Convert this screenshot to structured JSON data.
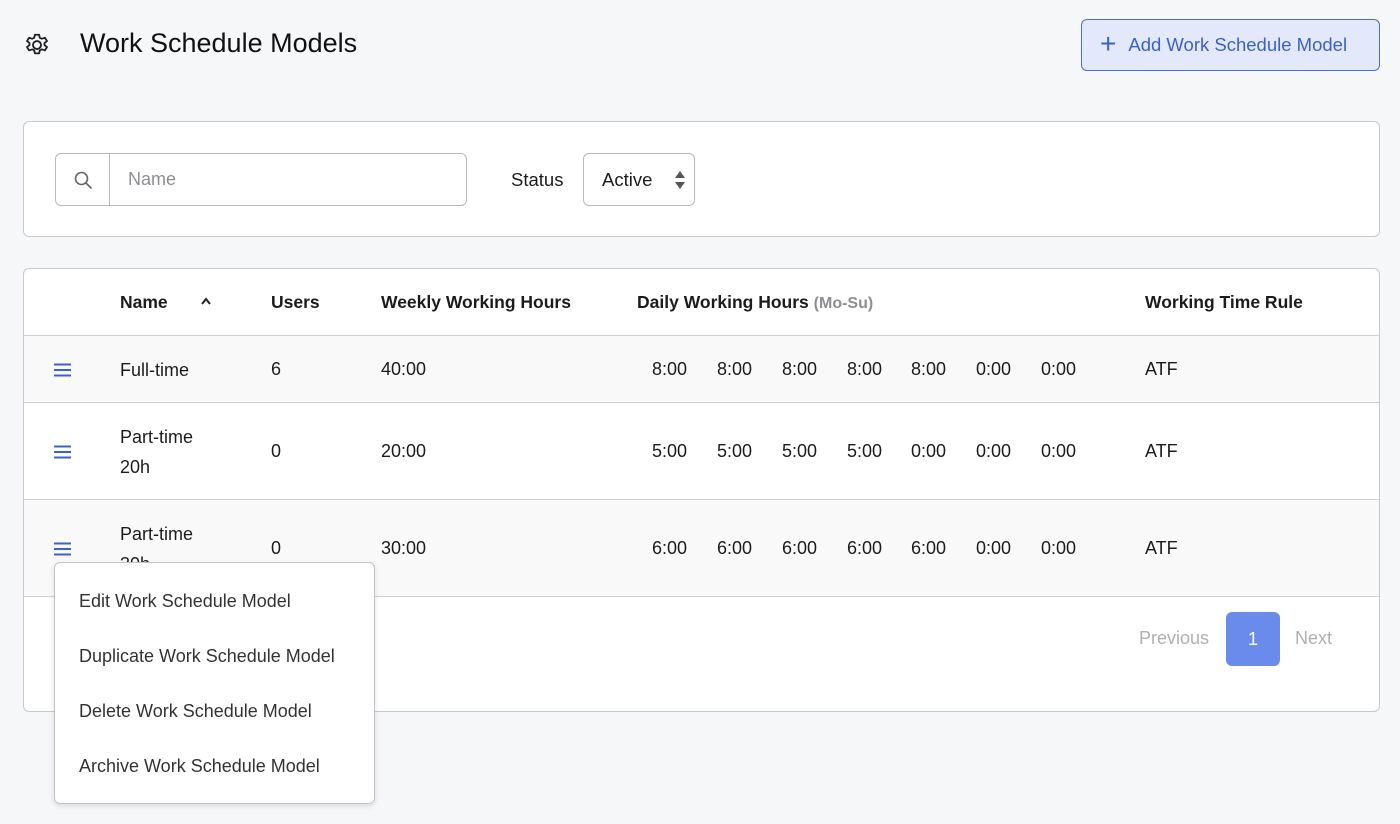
{
  "header": {
    "icon": "gear-icon",
    "title": "Work Schedule Models",
    "add_button_label": "Add Work Schedule Model",
    "add_button_icon": "plus-icon"
  },
  "filters": {
    "search_placeholder": "Name",
    "search_value": "",
    "search_icon": "search-icon",
    "status_label": "Status",
    "status_value": "Active"
  },
  "table": {
    "columns": {
      "name": "Name",
      "users": "Users",
      "weekly": "Weekly Working Hours",
      "daily": "Daily Working Hours",
      "daily_suffix": "(Mo-Su)",
      "rule": "Working Time Rule"
    },
    "sort": {
      "column": "name",
      "direction": "ascending"
    },
    "rows": [
      {
        "name_line1": "Full-time",
        "name_line2": "",
        "users": "6",
        "weekly": "40:00",
        "daily": [
          "8:00",
          "8:00",
          "8:00",
          "8:00",
          "8:00",
          "0:00",
          "0:00"
        ],
        "rule": "ATF"
      },
      {
        "name_line1": "Part-time",
        "name_line2": "20h",
        "users": "0",
        "weekly": "20:00",
        "daily": [
          "5:00",
          "5:00",
          "5:00",
          "5:00",
          "0:00",
          "0:00",
          "0:00"
        ],
        "rule": "ATF"
      },
      {
        "name_line1": "Part-time",
        "name_line2": "30h",
        "users": "0",
        "weekly": "30:00",
        "daily": [
          "6:00",
          "6:00",
          "6:00",
          "6:00",
          "6:00",
          "0:00",
          "0:00"
        ],
        "rule": "ATF"
      }
    ]
  },
  "pagination": {
    "previous": "Previous",
    "current_page": "1",
    "next": "Next"
  },
  "context_menu": {
    "items": [
      "Edit Work Schedule Model",
      "Duplicate Work Schedule Model",
      "Delete Work Schedule Model",
      "Archive Work Schedule Model"
    ]
  },
  "colors": {
    "accent": "#3a62c9",
    "accent_bg": "#e3e9fb",
    "page_active": "#6b8bec",
    "background": "#f6f7f9"
  }
}
